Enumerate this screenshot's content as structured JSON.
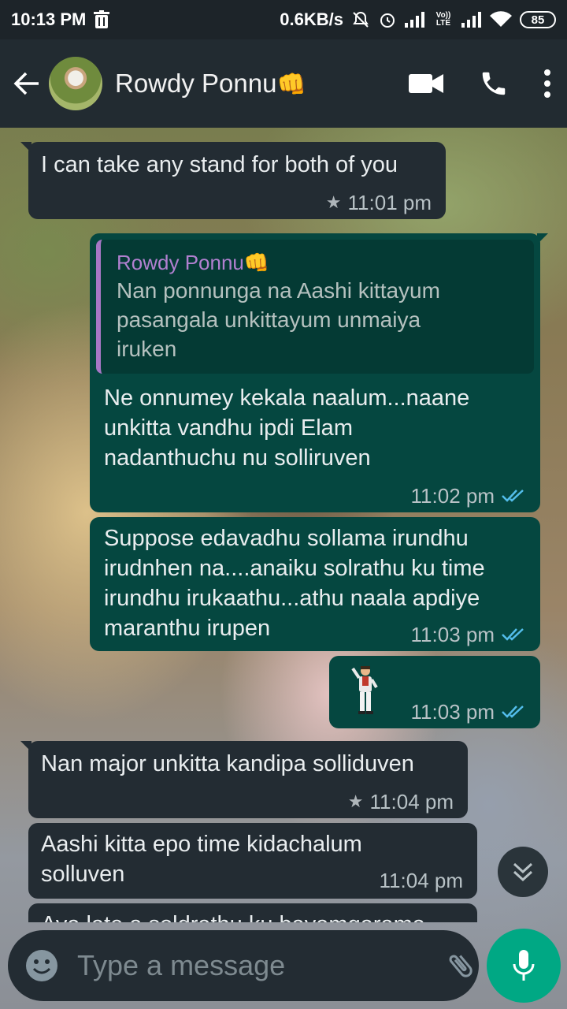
{
  "status_bar": {
    "time": "10:13 PM",
    "net_speed": "0.6KB/s",
    "volte": "Vo)) LTE",
    "battery": "85"
  },
  "header": {
    "contact_name": "Rowdy Ponnu",
    "contact_emoji": "👊"
  },
  "messages": [
    {
      "text": "I can take any stand for both of you",
      "time": "11:01 pm",
      "starred": true
    },
    {
      "quote_author": "Rowdy Ponnu👊",
      "quote_lines": [
        "Nan ponnunga na Aashi kittayum",
        "pasangala unkittayum unmaiya",
        "iruken"
      ],
      "lines": [
        "Ne onnumey kekala naalum...naane",
        "unkitta vandhu ipdi Elam",
        "nadanthuchu nu solliruven"
      ],
      "time": "11:02 pm",
      "status": "read"
    },
    {
      "lines": [
        "Suppose edavadhu sollama irundhu",
        "irudnhen na....anaiku solrathu ku time",
        "irundhu irukaathu...athu naala apdiye",
        "maranthu irupen"
      ],
      "time": "11:03 pm",
      "status": "read"
    },
    {
      "sticker": "dancing-man-sticker",
      "time": "11:03 pm",
      "status": "read"
    },
    {
      "text": "Nan major unkitta kandipa solliduven",
      "time": "11:04 pm",
      "starred": true
    },
    {
      "lines": [
        "Aashi kitta epo time kidachalum",
        "solluven"
      ],
      "time": "11:04 pm"
    },
    {
      "text": "Ava late a soldrathu ku bayamgarama"
    }
  ],
  "composer": {
    "placeholder": "Type a message"
  },
  "colors": {
    "header_bg": "#222b31",
    "incoming_bubble": "#232c33",
    "outgoing_bubble": "#054740",
    "accent_green": "#00a884",
    "read_tick": "#53bdeb",
    "quote_bar": "#a777c6"
  }
}
